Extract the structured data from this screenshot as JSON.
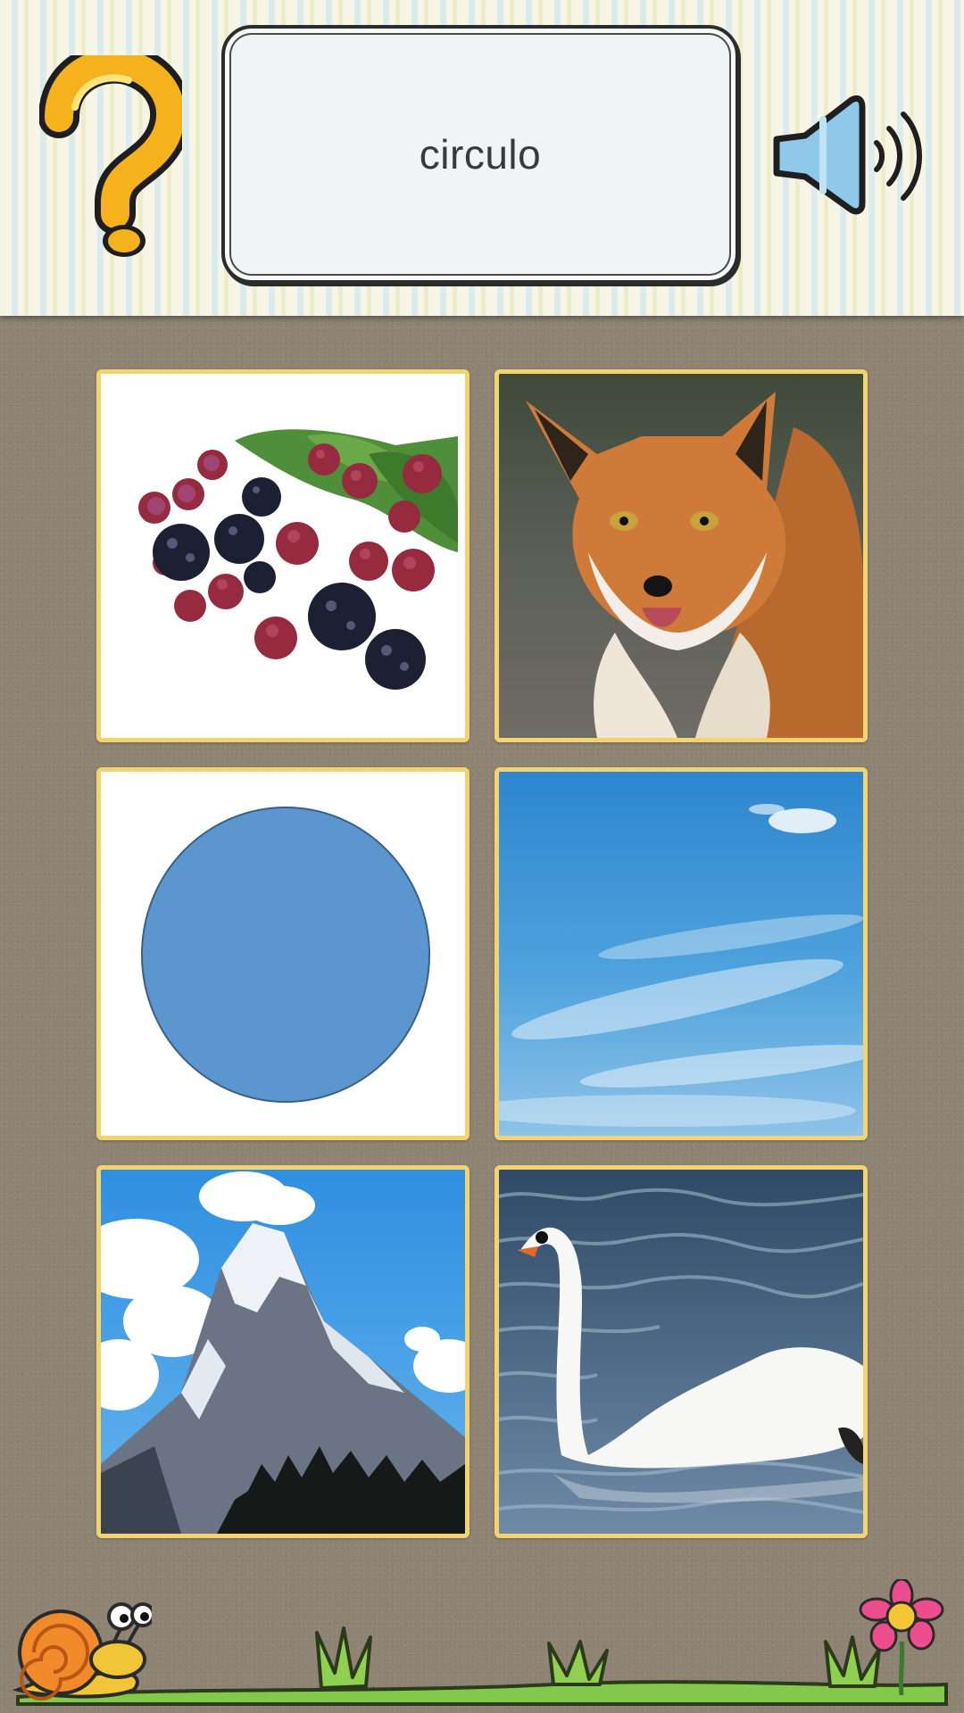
{
  "header": {
    "word": "circulo",
    "help_icon": "question-mark-icon",
    "sound_icon": "speaker-icon"
  },
  "cards": [
    {
      "subject": "blackberries"
    },
    {
      "subject": "fox"
    },
    {
      "subject": "circle"
    },
    {
      "subject": "sky"
    },
    {
      "subject": "mountain"
    },
    {
      "subject": "swan"
    }
  ],
  "colors": {
    "card_border": "#f3d36f",
    "circle_fill": "#5b96cf",
    "background": "#8f8474"
  },
  "decorations": [
    "snail",
    "grass",
    "flower"
  ]
}
